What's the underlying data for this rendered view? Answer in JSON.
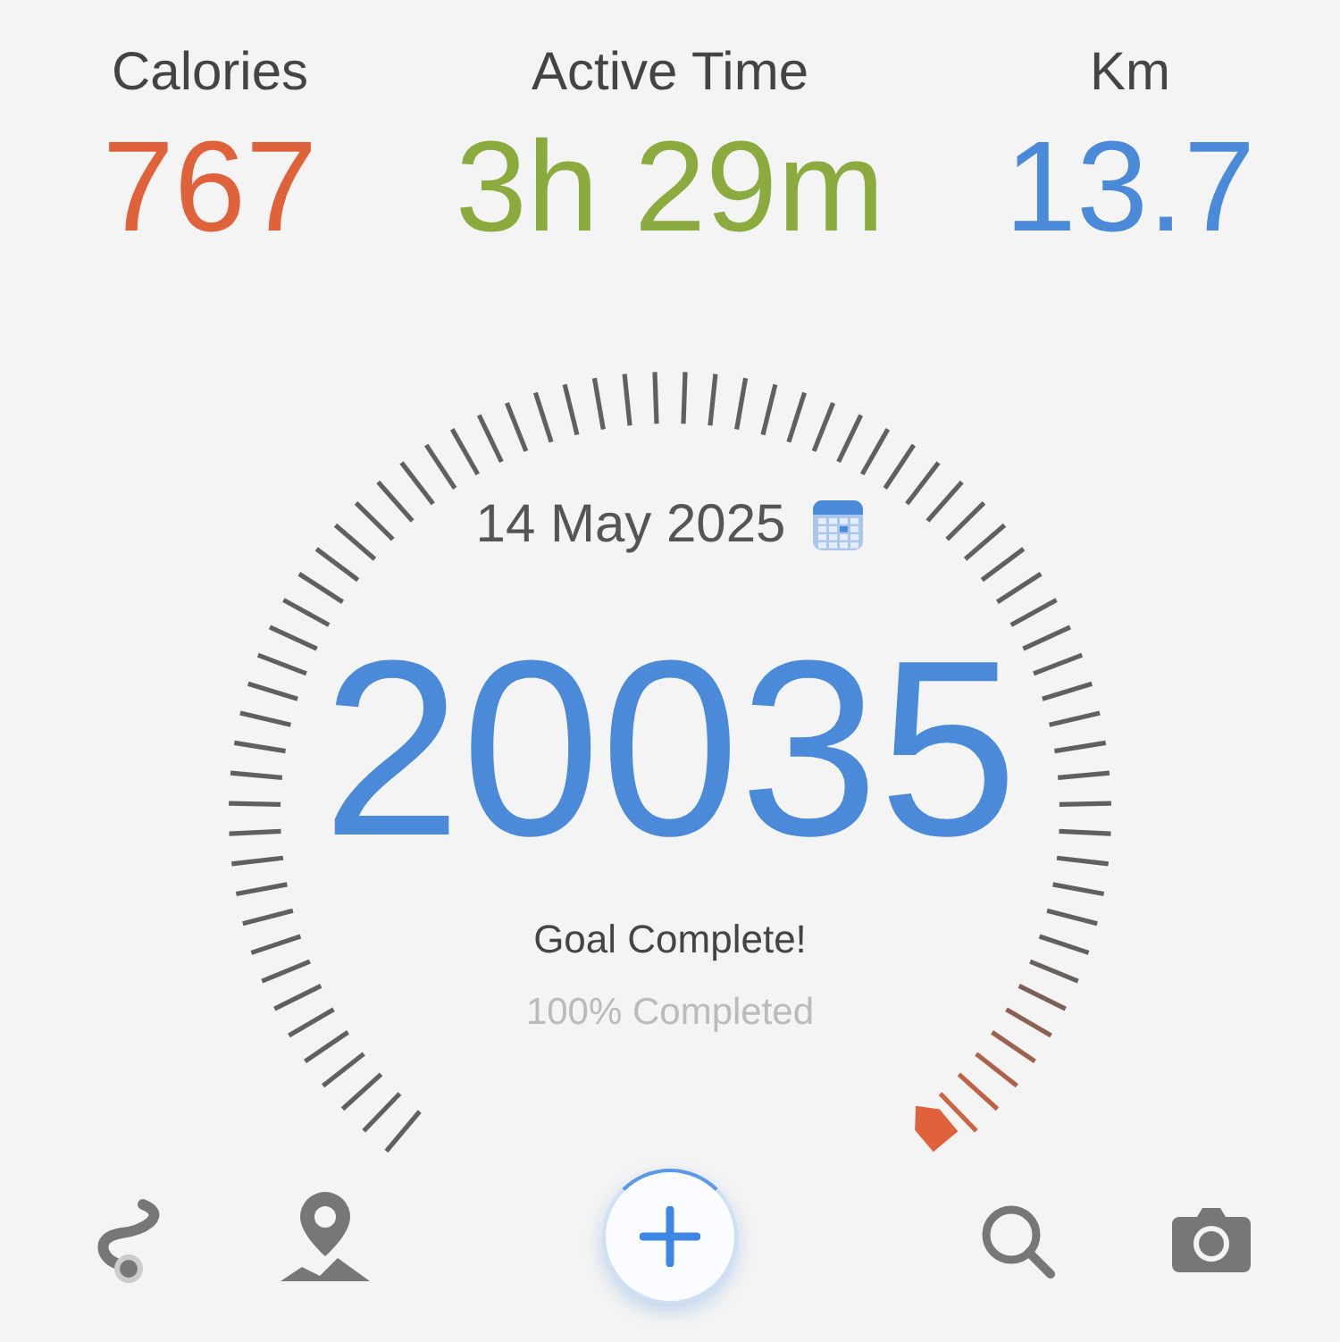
{
  "stats": [
    {
      "label": "Calories",
      "value": "767",
      "color": "#e0623a"
    },
    {
      "label": "Active Time",
      "value": "3h 29m",
      "color": "#8bab3f"
    },
    {
      "label": "Km",
      "value": "13.7",
      "color": "#4a8ad8"
    }
  ],
  "gauge": {
    "date": "14 May 2025",
    "steps": "20035",
    "message": "Goal Complete!",
    "progress": "100% Completed"
  }
}
